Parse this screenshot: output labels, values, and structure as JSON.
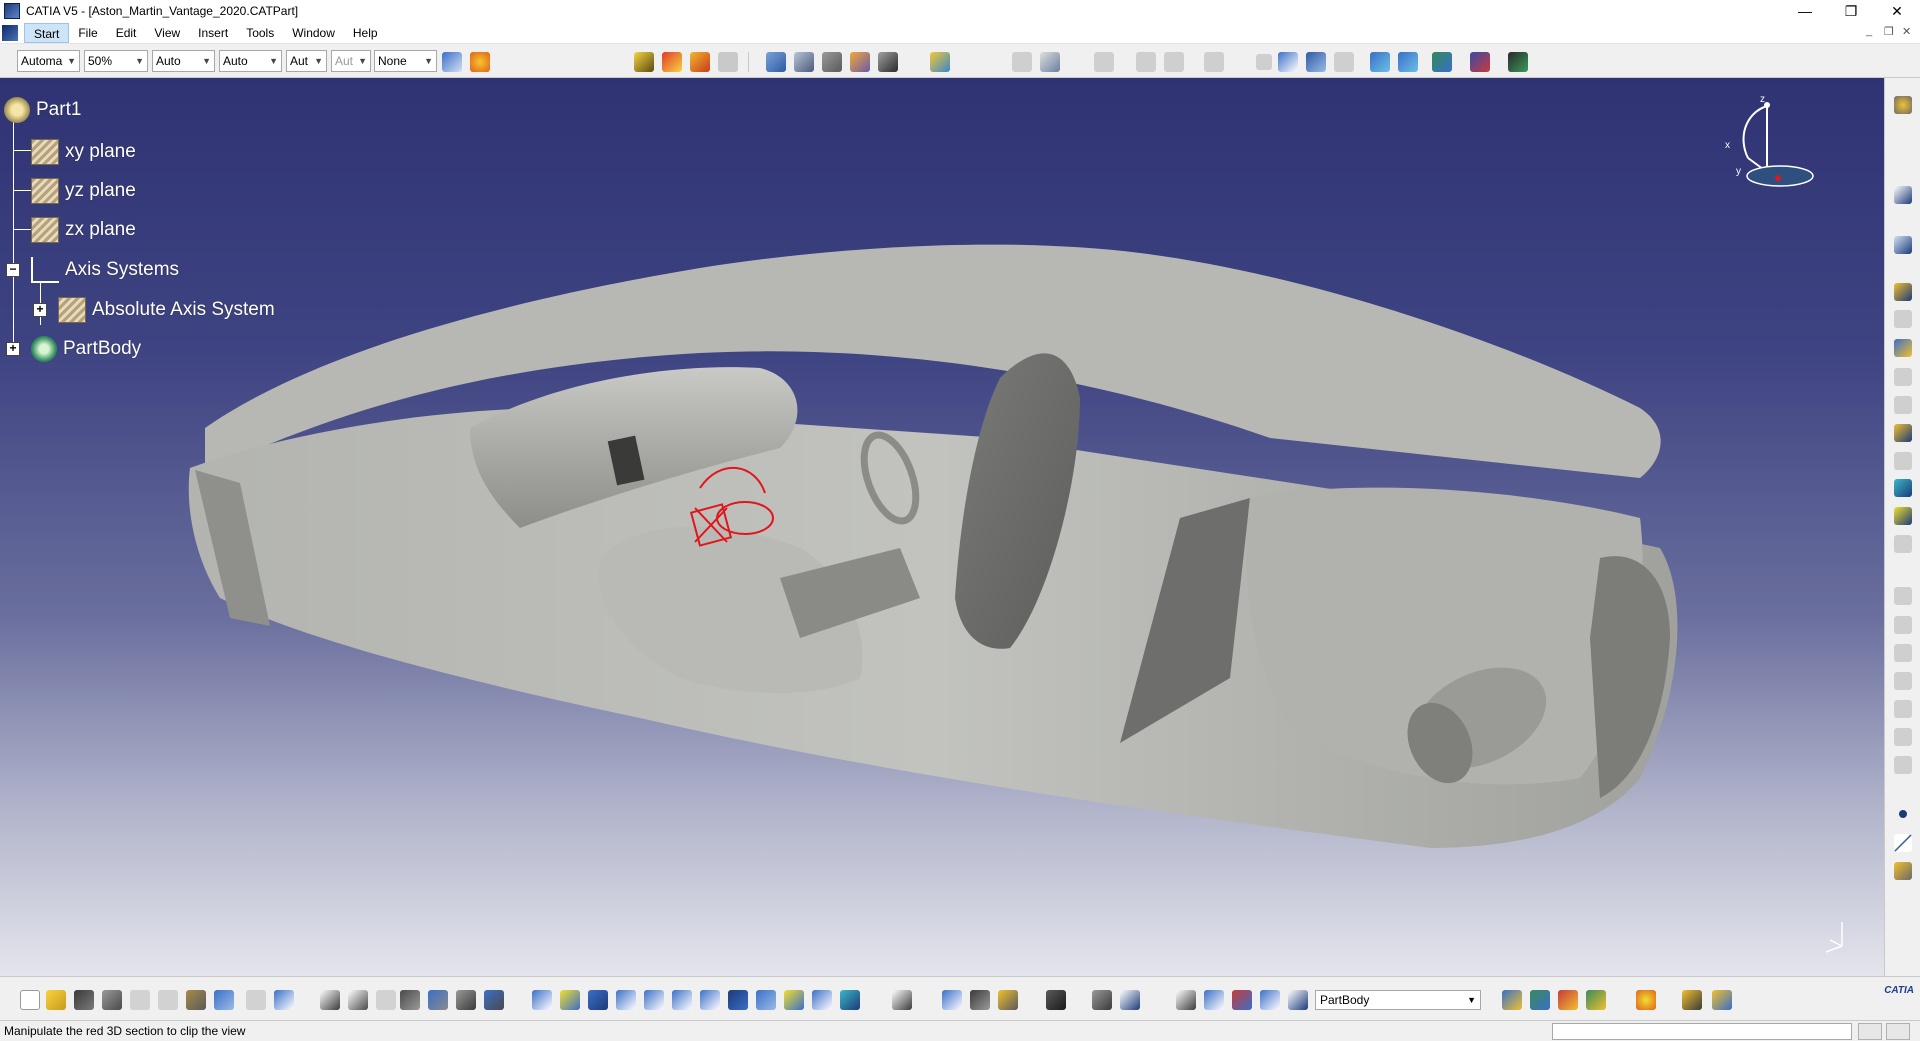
{
  "window": {
    "title": "CATIA V5 - [Aston_Martin_Vantage_2020.CATPart]",
    "minimize_glyph": "—",
    "restore_glyph": "❐",
    "close_glyph": "✕"
  },
  "menubar": {
    "items": [
      "Start",
      "File",
      "Edit",
      "View",
      "Insert",
      "Tools",
      "Window",
      "Help"
    ],
    "active": "Start"
  },
  "toolbar": {
    "combos": [
      {
        "value": "Automa",
        "enabled": true
      },
      {
        "value": "50%",
        "enabled": true
      },
      {
        "value": "Auto",
        "enabled": true
      },
      {
        "value": "Auto",
        "enabled": true
      },
      {
        "value": "Aut",
        "enabled": true
      },
      {
        "value": "Aut",
        "enabled": false
      },
      {
        "value": "None",
        "enabled": true
      }
    ]
  },
  "tree": {
    "root": "Part1",
    "nodes": [
      {
        "label": "xy plane",
        "icon": "plane-icon"
      },
      {
        "label": "yz plane",
        "icon": "plane-icon"
      },
      {
        "label": "zx plane",
        "icon": "plane-icon"
      },
      {
        "label": "Axis Systems",
        "icon": "axis-systems-icon"
      },
      {
        "label": "Absolute Axis System",
        "icon": "axis-system-icon"
      },
      {
        "label": "PartBody",
        "icon": "partbody-gear-icon"
      }
    ]
  },
  "compass": {
    "x": "x",
    "y": "y",
    "z": "z"
  },
  "bottombar": {
    "current_body": "PartBody",
    "logo": "CATIA"
  },
  "status": {
    "message": "Manipulate the red 3D section to clip the view",
    "command_value": ""
  },
  "colors": {
    "viewport_top": "#2f3373",
    "viewport_bottom": "#e4e5ec",
    "model_grey": "#a9aaa7",
    "section_red": "#e0161a"
  }
}
